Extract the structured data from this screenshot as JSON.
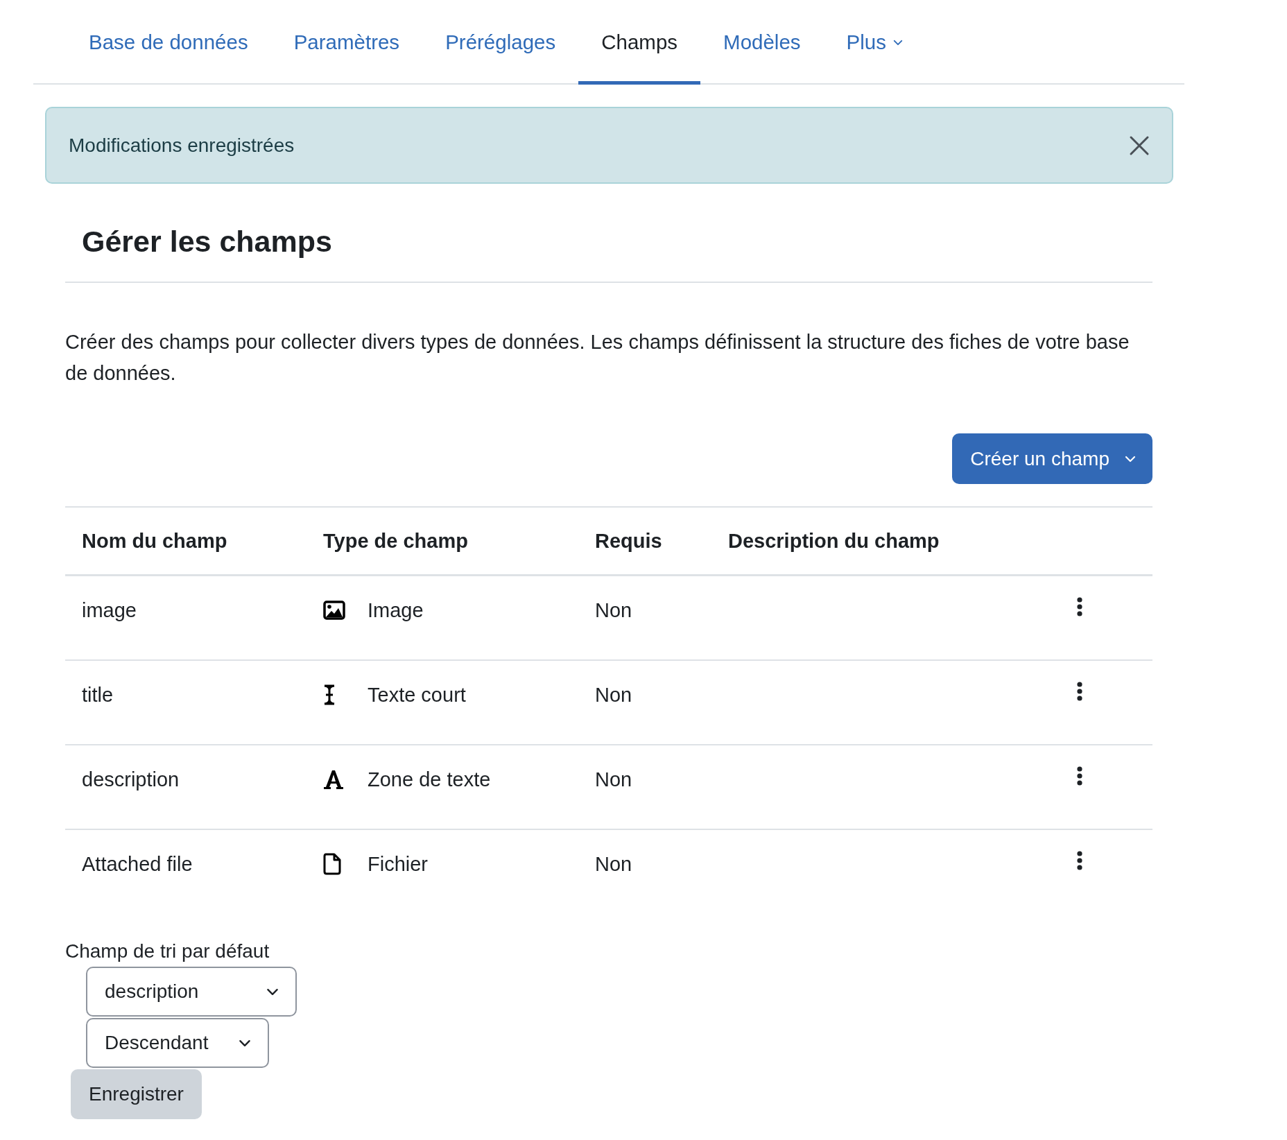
{
  "tabs": [
    {
      "label": "Base de données",
      "selected": false,
      "has_menu": false
    },
    {
      "label": "Paramètres",
      "selected": false,
      "has_menu": false
    },
    {
      "label": "Préréglages",
      "selected": false,
      "has_menu": false
    },
    {
      "label": "Champs",
      "selected": true,
      "has_menu": false
    },
    {
      "label": "Modèles",
      "selected": false,
      "has_menu": false
    },
    {
      "label": "Plus",
      "selected": false,
      "has_menu": true
    }
  ],
  "alert": {
    "message": "Modifications enregistrées"
  },
  "heading": "Gérer les champs",
  "intro": "Créer des champs pour collecter divers types de données. Les champs définissent la structure des fiches de votre base de données.",
  "create_button": "Créer un champ",
  "table": {
    "columns": [
      "Nom du champ",
      "Type de champ",
      "Requis",
      "Description du champ"
    ],
    "rows": [
      {
        "name": "image",
        "kind": "image",
        "type": "Image",
        "required": "Non"
      },
      {
        "name": "title",
        "kind": "text",
        "type": "Texte court",
        "required": "Non"
      },
      {
        "name": "description",
        "kind": "textarea",
        "type": "Zone de texte",
        "required": "Non"
      },
      {
        "name": "Attached file",
        "kind": "file",
        "type": "Fichier",
        "required": "Non"
      }
    ]
  },
  "sort": {
    "label": "Champ de tri par défaut",
    "field": "description",
    "order": "Descendant",
    "save_button": "Enregistrer"
  }
}
